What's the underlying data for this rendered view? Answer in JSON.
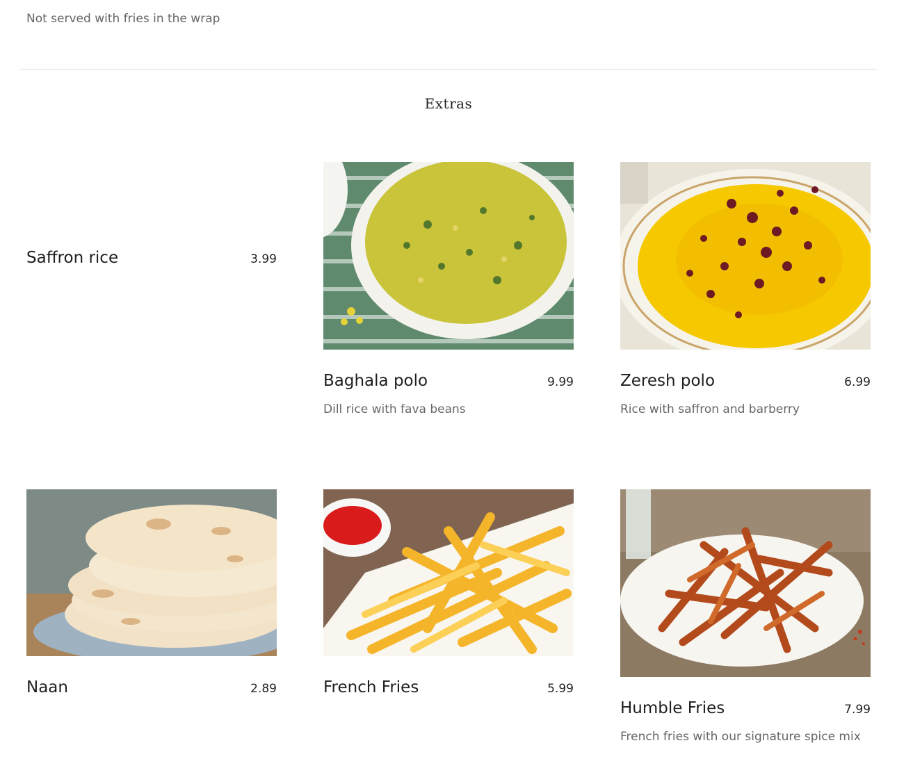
{
  "previous_item": {
    "note": "Not served with fries in the wrap"
  },
  "section": {
    "title": "Extras"
  },
  "items": [
    {
      "name": "Saffron rice",
      "price": "3.99"
    },
    {
      "name": "Baghala polo",
      "price": "9.99",
      "desc": "Dill rice with fava beans",
      "image": "dill-rice-photo"
    },
    {
      "name": "Zeresh polo",
      "price": "6.99",
      "desc": "Rice with saffron and barberry",
      "image": "barberry-rice-photo"
    },
    {
      "name": "Naan",
      "price": "2.89",
      "image": "naan-photo"
    },
    {
      "name": "French Fries",
      "price": "5.99",
      "image": "french-fries-photo"
    },
    {
      "name": "Humble Fries",
      "price": "7.99",
      "desc": "French fries with our signature spice mix",
      "image": "spiced-fries-photo"
    }
  ]
}
